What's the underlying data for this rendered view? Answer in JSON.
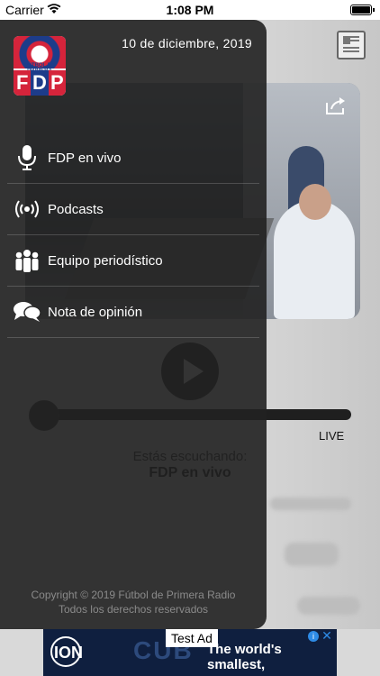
{
  "status_bar": {
    "carrier": "Carrier",
    "time": "1:08 PM"
  },
  "drawer": {
    "logo_top_text": "FÚTBOL DE PRIMERA",
    "logo_letters": [
      "F",
      "D",
      "P"
    ],
    "date": "10 de diciembre, 2019",
    "menu": [
      {
        "label": "FDP en vivo",
        "icon": "microphone-icon"
      },
      {
        "label": "Podcasts",
        "icon": "broadcast-icon"
      },
      {
        "label": "Equipo periodístico",
        "icon": "team-icon"
      },
      {
        "label": "Nota de opinión",
        "icon": "chat-bubbles-icon"
      }
    ],
    "footer": {
      "copyright": "Copyright © 2019 Fútbol de Primera Radio",
      "rights": "Todos los derechos reservados"
    }
  },
  "player": {
    "live_label": "LIVE",
    "listening_label": "Estás escuchando:",
    "station_name": "FDP en vivo",
    "progress": 0.0
  },
  "ad": {
    "test_label": "Test Ad",
    "brand": "ION",
    "product": "CUB",
    "tagline": "The world's smallest,",
    "info_icon": "info-icon",
    "close_icon": "close-icon"
  },
  "colors": {
    "drawer_bg": "#212121",
    "logo_red": "#d5243b",
    "logo_blue": "#1d3c8a",
    "ad_bg": "#0f1f3f"
  }
}
